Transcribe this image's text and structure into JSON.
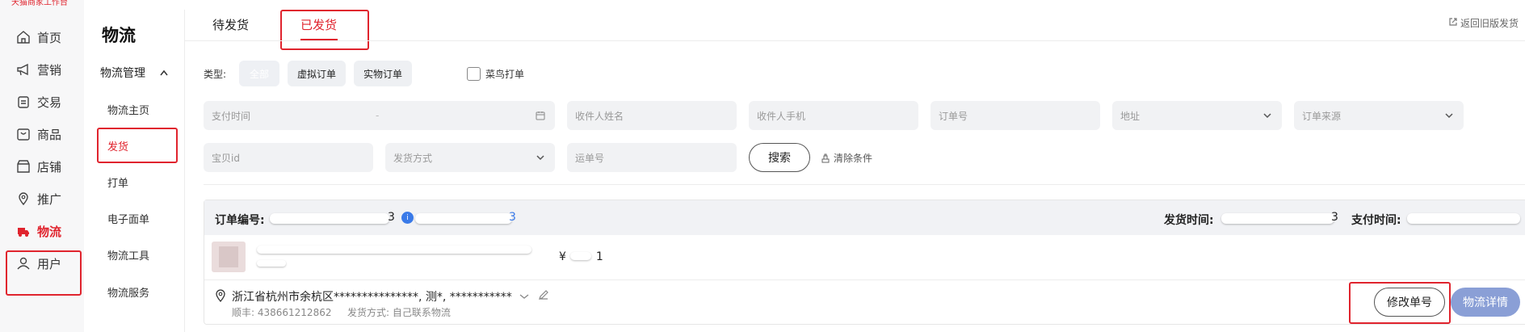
{
  "brand": {
    "text": "天猫商家工作台"
  },
  "left_nav": [
    {
      "label": "首页",
      "icon": "home-icon"
    },
    {
      "label": "营销",
      "icon": "megaphone-icon"
    },
    {
      "label": "交易",
      "icon": "clipboard-icon"
    },
    {
      "label": "商品",
      "icon": "product-icon"
    },
    {
      "label": "店铺",
      "icon": "store-icon"
    },
    {
      "label": "推广",
      "icon": "location-pin-icon"
    },
    {
      "label": "物流",
      "icon": "logistics-icon",
      "active": true
    },
    {
      "label": "用户",
      "icon": "user-icon"
    }
  ],
  "sub_nav": {
    "title": "物流",
    "group": "物流管理",
    "items": [
      {
        "label": "物流主页"
      },
      {
        "label": "发货",
        "active": true
      },
      {
        "label": "打单"
      },
      {
        "label": "电子面单"
      },
      {
        "label": "物流工具"
      },
      {
        "label": "物流服务"
      }
    ]
  },
  "tabs": [
    {
      "label": "待发货"
    },
    {
      "label": "已发货",
      "active": true
    }
  ],
  "return_link": "返回旧版发货",
  "filters": {
    "type_label": "类型:",
    "type_options": [
      "全部",
      "虚拟订单",
      "实物订单"
    ],
    "cainiao_label": "菜鸟打单",
    "pay_time_placeholder": "支付时间",
    "range_sep": "-",
    "receiver_name_placeholder": "收件人姓名",
    "receiver_phone_placeholder": "收件人手机",
    "order_no_placeholder": "订单号",
    "address_placeholder": "地址",
    "order_source_placeholder": "订单来源",
    "item_id_placeholder": "宝贝id",
    "ship_method_placeholder": "发货方式",
    "tracking_placeholder": "运单号",
    "search_label": "搜索",
    "clear_label": "清除条件"
  },
  "order": {
    "order_no_label": "订单编号:",
    "order_no_tail": "3",
    "order_no_tail2": "3",
    "ship_time_label": "发货时间:",
    "ship_time_tail": "3",
    "pay_time_label": "支付时间:",
    "price_prefix": "¥",
    "price_tail": "1",
    "address": "浙江省杭州市余杭区***************, 测*, ***********",
    "carrier_tracking": "顺丰: 438661212862",
    "ship_method": "发货方式: 自己联系物流",
    "modify_label": "修改单号",
    "detail_label": "物流详情"
  },
  "colors": {
    "accent": "#e0242e",
    "link": "#3a7ae8",
    "button_blue": "#8a9fd6"
  }
}
